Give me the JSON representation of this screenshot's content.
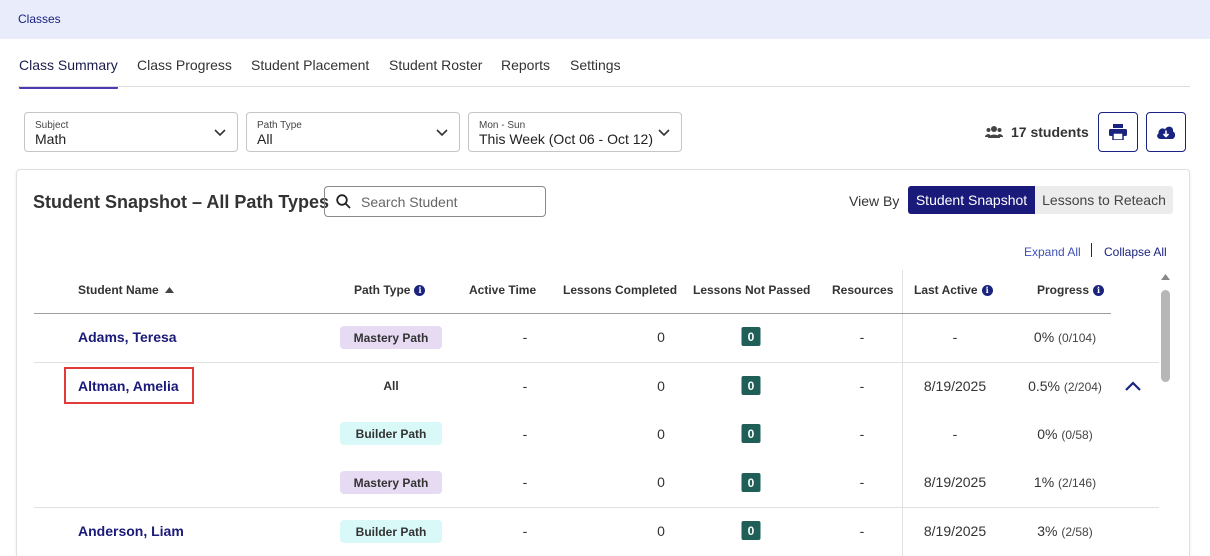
{
  "breadcrumb": "Classes",
  "tabs": [
    {
      "label": "Class Summary",
      "active": true
    },
    {
      "label": "Class Progress",
      "active": false
    },
    {
      "label": "Student Placement",
      "active": false
    },
    {
      "label": "Student Roster",
      "active": false
    },
    {
      "label": "Reports",
      "active": false
    },
    {
      "label": "Settings",
      "active": false
    }
  ],
  "filters": {
    "subject": {
      "label": "Subject",
      "value": "Math"
    },
    "path_type": {
      "label": "Path Type",
      "value": "All"
    },
    "week": {
      "label": "Mon - Sun",
      "value": "This Week (Oct 06 - Oct 12)"
    }
  },
  "students_count": "17 students",
  "snapshot": {
    "title": "Student Snapshot – All Path Types",
    "search_placeholder": "Search Student",
    "view_by": "View By",
    "view_options": [
      "Student Snapshot",
      "Lessons to Reteach"
    ],
    "expand_all": "Expand All",
    "collapse_all": "Collapse All"
  },
  "columns": {
    "student_name": "Student Name",
    "path_type": "Path Type",
    "active_time": "Active Time",
    "lessons_completed": "Lessons Completed",
    "lessons_not_passed": "Lessons Not Passed",
    "resources": "Resources",
    "last_active": "Last Active",
    "progress": "Progress"
  },
  "rows": [
    {
      "name": "Adams, Teresa",
      "path": "Mastery Path",
      "active_time": "-",
      "completed": "0",
      "not_passed": "0",
      "resources": "-",
      "last_active": "-",
      "progress_pct": "0%",
      "progress_frac": "(0/104)"
    },
    {
      "name": "Altman, Amelia",
      "path": "All",
      "active_time": "-",
      "completed": "0",
      "not_passed": "0",
      "resources": "-",
      "last_active": "8/19/2025",
      "progress_pct": "0.5%",
      "progress_frac": "(2/204)"
    },
    {
      "name": "",
      "path": "Builder Path",
      "active_time": "-",
      "completed": "0",
      "not_passed": "0",
      "resources": "-",
      "last_active": "-",
      "progress_pct": "0%",
      "progress_frac": "(0/58)"
    },
    {
      "name": "",
      "path": "Mastery Path",
      "active_time": "-",
      "completed": "0",
      "not_passed": "0",
      "resources": "-",
      "last_active": "8/19/2025",
      "progress_pct": "1%",
      "progress_frac": "(2/146)"
    },
    {
      "name": "Anderson, Liam",
      "path": "Builder Path",
      "active_time": "-",
      "completed": "0",
      "not_passed": "0",
      "resources": "-",
      "last_active": "8/19/2025",
      "progress_pct": "3%",
      "progress_frac": "(2/58)"
    }
  ],
  "colors": {
    "accent": "#1a1a7a",
    "tab_underline": "#4b3ab4",
    "badge": "#1f5f58",
    "mastery": "#e6dbf3",
    "builder": "#d9f8f8",
    "topbar": "#e8ecfb"
  }
}
